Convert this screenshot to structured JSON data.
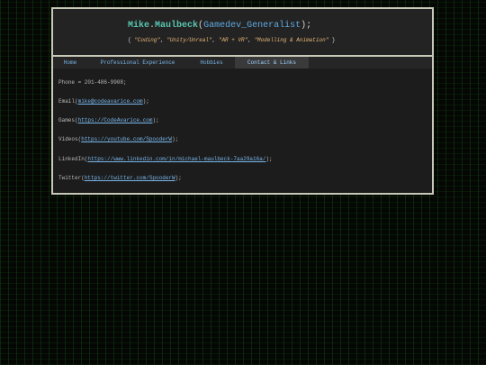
{
  "header": {
    "name_first": "Mike",
    "name_last": "Maulbeck",
    "role": "Gamedev_Generalist",
    "subtitle_items": [
      "\"Coding\"",
      "\"Unity/Unreal\"",
      "\"AR + VR\"",
      "\"Modelling & Animation\""
    ]
  },
  "nav": {
    "tabs": [
      {
        "label": "Home"
      },
      {
        "label": "Professional Experience"
      },
      {
        "label": "Hobbies"
      },
      {
        "label": "Contact & Links"
      }
    ]
  },
  "contact": {
    "phone": "Phone = 201-486-9908;",
    "email_prefix": "Email(",
    "email": "mike@codeavarice.com",
    "games_prefix": "Games(",
    "games": "https://CodeAvarice.com",
    "videos_prefix": "Videos(",
    "videos": "https://youtube.com/SpooderW",
    "linkedin_prefix": "LinkedIn(",
    "linkedin": "https://www.linkedin.com/in/michael-maulbeck-7aa29a16a/",
    "twitter_prefix": "Twitter(",
    "twitter": "https://twitter.com/SpooderW",
    "suffix": ");"
  }
}
